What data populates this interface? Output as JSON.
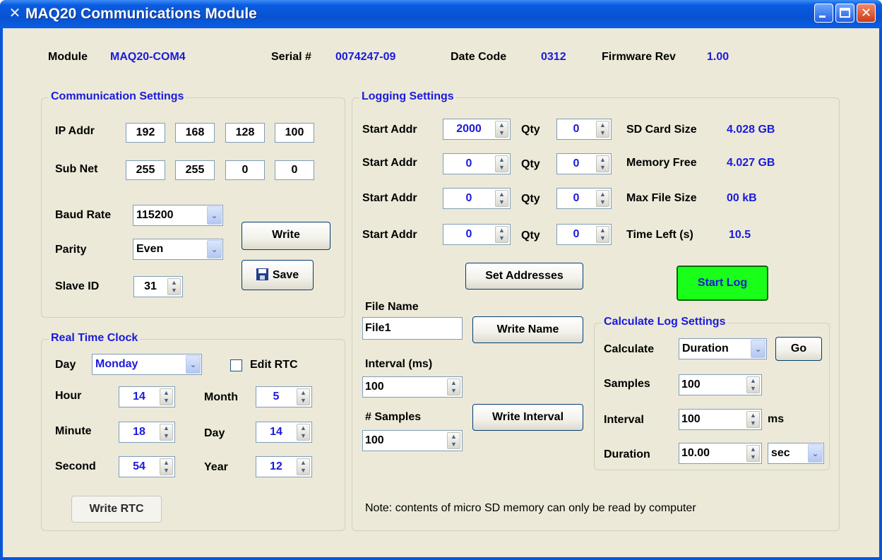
{
  "window": {
    "title": "MAQ20 Communications Module",
    "icon": "tools-icon"
  },
  "header": {
    "module_label": "Module",
    "module_value": "MAQ20-COM4",
    "serial_label": "Serial #",
    "serial_value": "0074247-09",
    "datecode_label": "Date Code",
    "datecode_value": "0312",
    "firmware_label": "Firmware Rev",
    "firmware_value": "1.00"
  },
  "comm": {
    "title": "Communication Settings",
    "ip_label": "IP Addr",
    "ip": [
      "192",
      "168",
      "128",
      "100"
    ],
    "subnet_label": "Sub Net",
    "subnet": [
      "255",
      "255",
      "0",
      "0"
    ],
    "baud_label": "Baud Rate",
    "baud_value": "115200",
    "parity_label": "Parity",
    "parity_value": "Even",
    "slave_label": "Slave ID",
    "slave_value": "31",
    "write_label": "Write",
    "save_label": "Save"
  },
  "rtc": {
    "title": "Real Time Clock",
    "day_label": "Day",
    "day_value": "Monday",
    "edit_label": "Edit RTC",
    "hour_label": "Hour",
    "hour_value": "14",
    "minute_label": "Minute",
    "minute_value": "18",
    "second_label": "Second",
    "second_value": "54",
    "month_label": "Month",
    "month_value": "5",
    "dom_label": "Day",
    "dom_value": "14",
    "year_label": "Year",
    "year_value": "12",
    "write_label": "Write RTC"
  },
  "logging": {
    "title": "Logging Settings",
    "start_label": "Start Addr",
    "qty_label": "Qty",
    "rows": [
      {
        "start": "2000",
        "qty": "0"
      },
      {
        "start": "0",
        "qty": "0"
      },
      {
        "start": "0",
        "qty": "0"
      },
      {
        "start": "0",
        "qty": "0"
      }
    ],
    "sd_label": "SD Card Size",
    "sd_value": "4.028 GB",
    "mem_label": "Memory Free",
    "mem_value": "4.027 GB",
    "maxfile_label": "Max File Size",
    "maxfile_value": "00 kB",
    "timeleft_label": "Time Left (s)",
    "timeleft_value": "10.5",
    "set_addresses_label": "Set Addresses",
    "start_log_label": "Start Log",
    "file_name_label": "File Name",
    "file_name_value": "File1",
    "write_name_label": "Write Name",
    "interval_label": "Interval (ms)",
    "interval_value": "100",
    "samples_label": "# Samples",
    "samples_value": "100",
    "write_interval_label": "Write Interval",
    "note": "Note: contents of micro SD memory can only be read by computer"
  },
  "calc": {
    "title": "Calculate Log Settings",
    "calculate_label": "Calculate",
    "calculate_value": "Duration",
    "go_label": "Go",
    "samples_label": "Samples",
    "samples_value": "100",
    "interval_label": "Interval",
    "interval_value": "100",
    "interval_unit": "ms",
    "duration_label": "Duration",
    "duration_value": "10.00",
    "duration_unit": "sec"
  },
  "colors": {
    "accent": "#1a1adc",
    "start_log_bg": "#19ff19",
    "panel_bg": "#ece9d8"
  }
}
